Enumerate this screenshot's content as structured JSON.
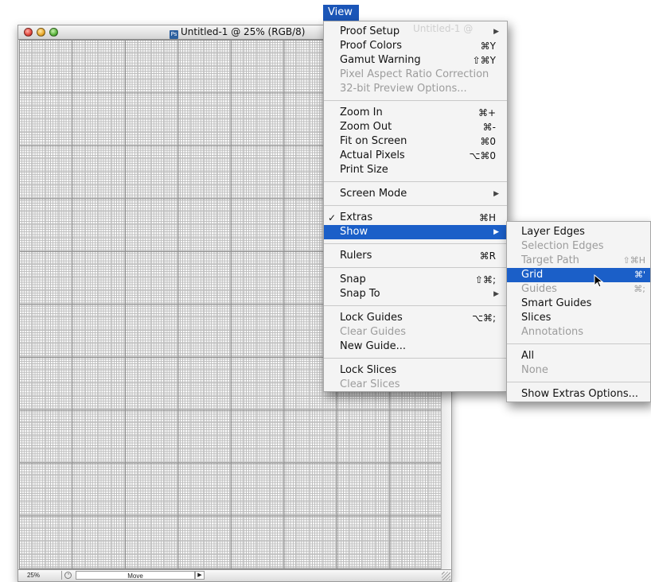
{
  "document": {
    "title": "Untitled-1 @ 25% (RGB/8)",
    "zoom": "25%",
    "tool": "Move"
  },
  "menubar": {
    "title": "View"
  },
  "view_menu": {
    "ghost_title": "Untitled-1 @",
    "groups": [
      [
        {
          "label": "Proof Setup",
          "shortcut": "",
          "submenu": true,
          "disabled": false
        },
        {
          "label": "Proof Colors",
          "shortcut": "⌘Y",
          "submenu": false,
          "disabled": false
        },
        {
          "label": "Gamut Warning",
          "shortcut": "⇧⌘Y",
          "submenu": false,
          "disabled": false
        },
        {
          "label": "Pixel Aspect Ratio Correction",
          "shortcut": "",
          "submenu": false,
          "disabled": true
        },
        {
          "label": "32-bit Preview Options...",
          "shortcut": "",
          "submenu": false,
          "disabled": true
        }
      ],
      [
        {
          "label": "Zoom In",
          "shortcut": "⌘+"
        },
        {
          "label": "Zoom Out",
          "shortcut": "⌘-"
        },
        {
          "label": "Fit on Screen",
          "shortcut": "⌘0"
        },
        {
          "label": "Actual Pixels",
          "shortcut": "⌥⌘0"
        },
        {
          "label": "Print Size",
          "shortcut": ""
        }
      ],
      [
        {
          "label": "Screen Mode",
          "shortcut": "",
          "submenu": true
        }
      ],
      [
        {
          "label": "Extras",
          "shortcut": "⌘H",
          "checked": true
        },
        {
          "label": "Show",
          "shortcut": "",
          "submenu": true,
          "highlight": true
        }
      ],
      [
        {
          "label": "Rulers",
          "shortcut": "⌘R"
        }
      ],
      [
        {
          "label": "Snap",
          "shortcut": "⇧⌘;"
        },
        {
          "label": "Snap To",
          "shortcut": "",
          "submenu": true
        }
      ],
      [
        {
          "label": "Lock Guides",
          "shortcut": "⌥⌘;"
        },
        {
          "label": "Clear Guides",
          "shortcut": "",
          "disabled": true
        },
        {
          "label": "New Guide...",
          "shortcut": ""
        }
      ],
      [
        {
          "label": "Lock Slices",
          "shortcut": ""
        },
        {
          "label": "Clear Slices",
          "shortcut": "",
          "disabled": true
        }
      ]
    ]
  },
  "show_menu": {
    "groups": [
      [
        {
          "label": "Layer Edges",
          "shortcut": ""
        },
        {
          "label": "Selection Edges",
          "shortcut": "",
          "disabled": true
        },
        {
          "label": "Target Path",
          "shortcut": "⇧⌘H",
          "disabled": true
        },
        {
          "label": "Grid",
          "shortcut": "⌘'",
          "highlight": true
        },
        {
          "label": "Guides",
          "shortcut": "⌘;",
          "disabled": true
        },
        {
          "label": "Smart Guides",
          "shortcut": ""
        },
        {
          "label": "Slices",
          "shortcut": ""
        },
        {
          "label": "Annotations",
          "shortcut": "",
          "disabled": true
        }
      ],
      [
        {
          "label": "All",
          "shortcut": ""
        },
        {
          "label": "None",
          "shortcut": "",
          "disabled": true
        }
      ],
      [
        {
          "label": "Show Extras Options...",
          "shortcut": ""
        }
      ]
    ]
  },
  "colors": {
    "highlight": "#1b5fc8",
    "menu_bg": "#f4f4f4",
    "disabled_text": "#9c9c9c"
  },
  "icons": {
    "submenu": "▶",
    "check": "✓",
    "status": "◔",
    "status_arrow": "▶"
  }
}
